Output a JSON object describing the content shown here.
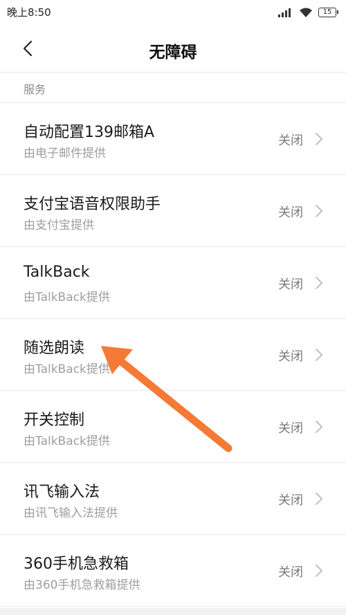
{
  "status_bar": {
    "time": "晚上8:50",
    "battery": "15",
    "icons": [
      "signal-icon",
      "wifi-icon",
      "battery-icon"
    ]
  },
  "header": {
    "title": "无障碍",
    "back_icon": "chevron-left-icon"
  },
  "section": {
    "label": "服务"
  },
  "items": [
    {
      "title": "自动配置139邮箱A",
      "subtitle": "由电子邮件提供",
      "status": "关闭"
    },
    {
      "title": "支付宝语音权限助手",
      "subtitle": "由支付宝提供",
      "status": "关闭"
    },
    {
      "title": "TalkBack",
      "subtitle": "由TalkBack提供",
      "status": "关闭"
    },
    {
      "title": "随选朗读",
      "subtitle": "由TalkBack提供",
      "status": "关闭"
    },
    {
      "title": "开关控制",
      "subtitle": "由TalkBack提供",
      "status": "关闭"
    },
    {
      "title": "讯飞输入法",
      "subtitle": "由讯飞输入法提供",
      "status": "关闭"
    },
    {
      "title": "360手机急救箱",
      "subtitle": "由360手机急救箱提供",
      "status": "关闭"
    }
  ],
  "colors": {
    "annotation_arrow": "#f47a35",
    "divider": "#e8e8e8",
    "secondary_text": "#9e9e9e"
  }
}
